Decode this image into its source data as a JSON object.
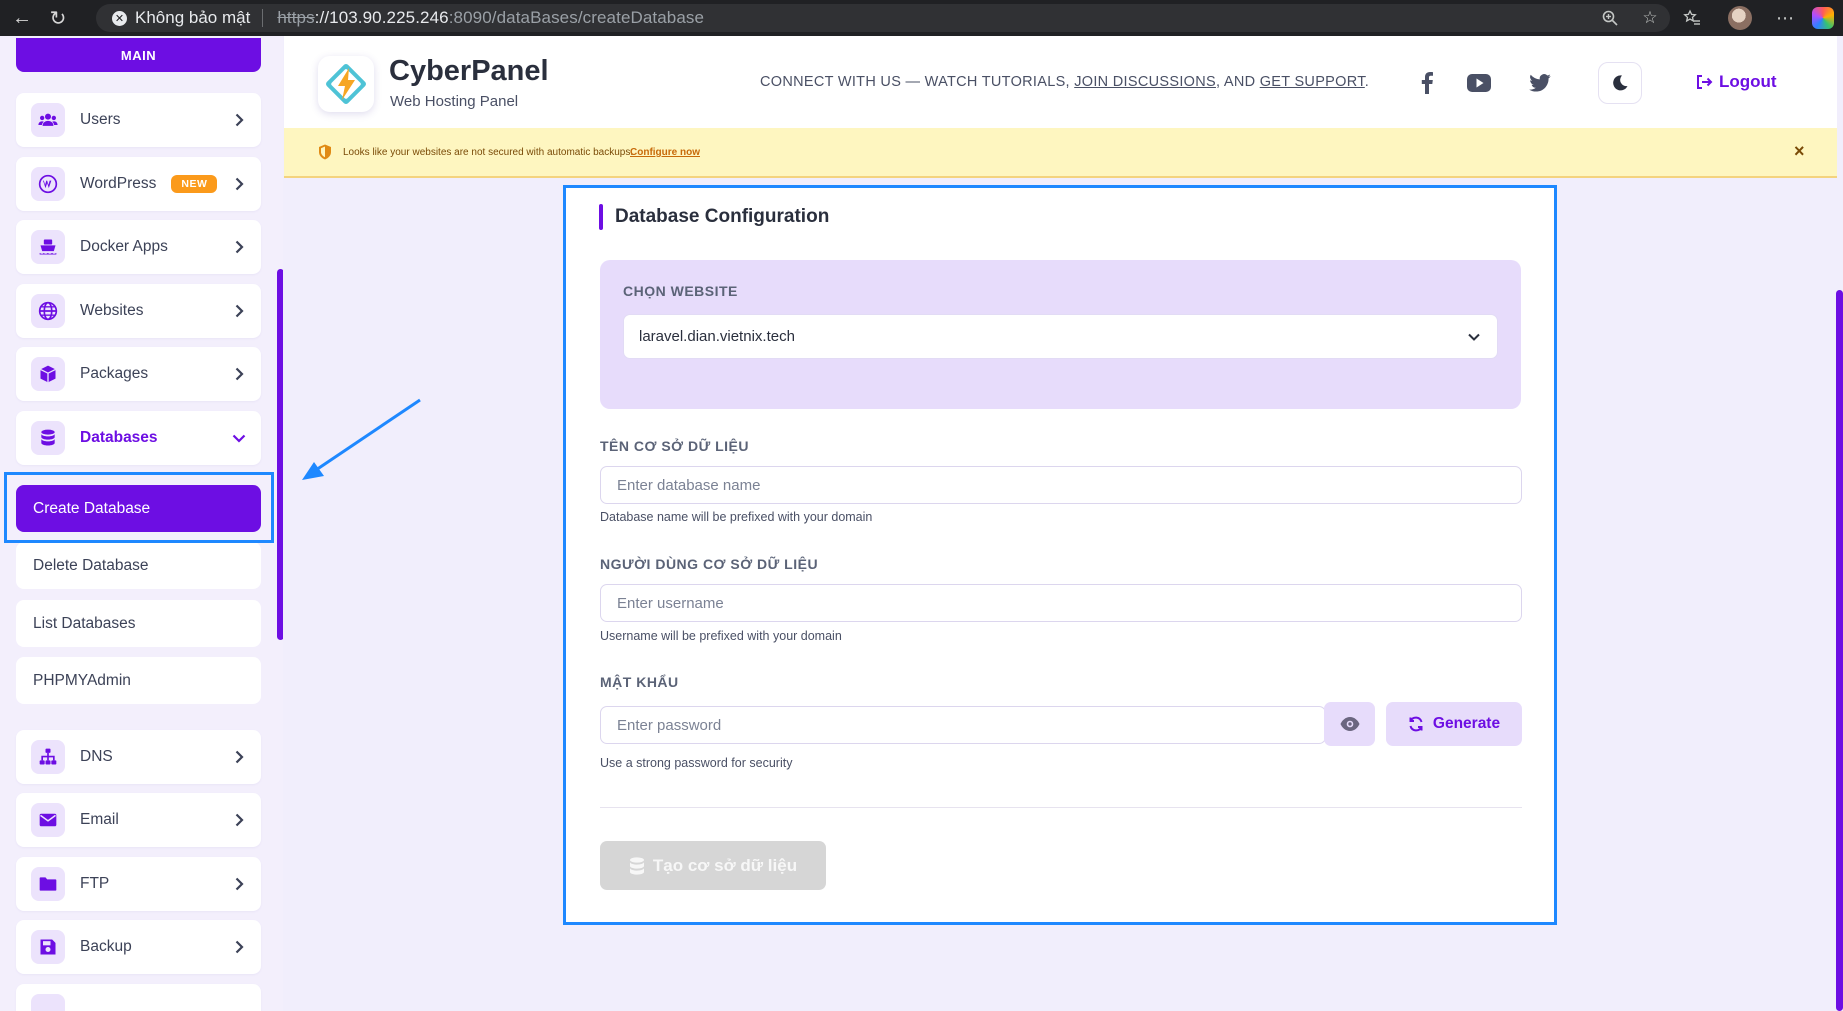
{
  "browser": {
    "security_label": "Không bảo mật",
    "url_scheme": "https",
    "url_host": "://103.90.225.246",
    "url_port": ":8090",
    "url_path": "/dataBases/createDatabase"
  },
  "sidebar": {
    "section_label": "MAIN",
    "items": [
      {
        "label": "Users",
        "icon": "users-icon"
      },
      {
        "label": "WordPress",
        "icon": "wordpress-icon",
        "badge": "NEW"
      },
      {
        "label": "Docker Apps",
        "icon": "docker-icon"
      },
      {
        "label": "Websites",
        "icon": "globe-icon"
      },
      {
        "label": "Packages",
        "icon": "box-icon"
      },
      {
        "label": "Databases",
        "icon": "database-icon",
        "expanded": true
      },
      {
        "label": "DNS",
        "icon": "sitemap-icon"
      },
      {
        "label": "Email",
        "icon": "envelope-icon"
      },
      {
        "label": "FTP",
        "icon": "folder-icon"
      },
      {
        "label": "Backup",
        "icon": "save-icon"
      }
    ],
    "sub_items": [
      {
        "label": "Create Database",
        "active": true
      },
      {
        "label": "Delete Database"
      },
      {
        "label": "List Databases"
      },
      {
        "label": "PHPMYAdmin"
      }
    ]
  },
  "header": {
    "brand": "CyberPanel",
    "subtitle": "Web Hosting Panel",
    "connect_prefix": "CONNECT WITH US — WATCH TUTORIALS, ",
    "connect_link1": "JOIN DISCUSSIONS",
    "connect_mid": ", AND ",
    "connect_link2": "GET SUPPORT",
    "connect_suffix": ".",
    "logout_label": "Logout"
  },
  "warning": {
    "text": "Looks like your websites are not secured with automatic backups.",
    "link": "Configure now",
    "close": "×"
  },
  "form": {
    "title": "Database Configuration",
    "website_label": "CHỌN WEBSITE",
    "website_value": "laravel.dian.vietnix.tech",
    "dbname_label": "TÊN CƠ SỞ DỮ LIỆU",
    "dbname_placeholder": "Enter database name",
    "dbname_hint": "Database name will be prefixed with your domain",
    "user_label": "NGƯỜI DÙNG CƠ SỞ DỮ LIỆU",
    "user_placeholder": "Enter username",
    "user_hint": "Username will be prefixed with your domain",
    "password_label": "MẬT KHẨU",
    "password_placeholder": "Enter password",
    "password_hint": "Use a strong password for security",
    "generate_label": "Generate",
    "submit_label": "Tạo cơ sở dữ liệu"
  },
  "colors": {
    "accent": "#6d0ee3",
    "annotation": "#1e88ff",
    "warning_bg": "#fef6c0"
  }
}
